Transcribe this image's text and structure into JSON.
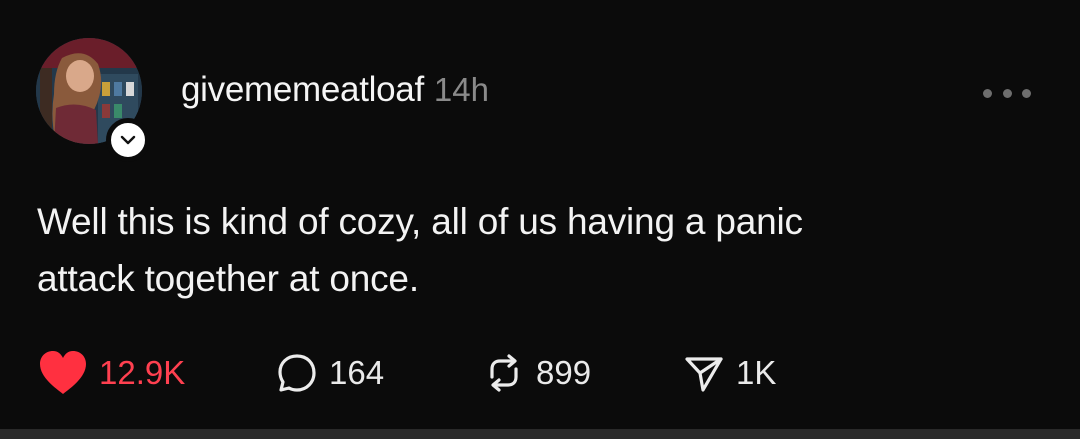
{
  "post": {
    "username": "givememeatloaf",
    "timestamp": "14h",
    "text_line1": "Well this is kind of cozy, all of us having a panic",
    "text_line2": "attack together at once.",
    "stats": {
      "likes": "12.9K",
      "replies": "164",
      "reposts": "899",
      "shares": "1K"
    }
  },
  "icons": {
    "avatar": "user-avatar",
    "follow": "chevron-down-icon",
    "more": "more-options-icon",
    "like": "heart-icon",
    "reply": "comment-bubble-icon",
    "repost": "repost-icon",
    "share": "send-icon"
  },
  "colors": {
    "background": "#0b0b0b",
    "like_active": "#ff3040",
    "muted": "#8a8a8a"
  }
}
